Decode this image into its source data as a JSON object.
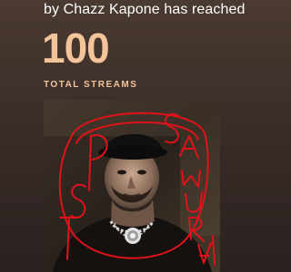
{
  "milestone": {
    "subtitle": "by Chazz Kapone has reached",
    "count": "100",
    "count_label": "TOTAL STREAMS"
  },
  "cover_art": {
    "scribble_color": "#e0131b",
    "scribble_text": "TSP SAMURAI"
  },
  "colors": {
    "accent": "#f3c39a",
    "background": "#3a2d28",
    "text": "#ffffff"
  }
}
